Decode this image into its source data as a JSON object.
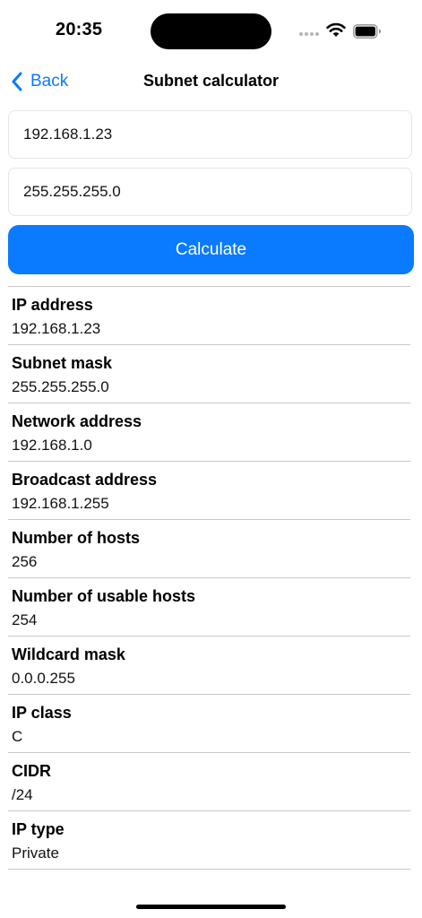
{
  "status_bar": {
    "time": "20:35"
  },
  "nav": {
    "back_label": "Back",
    "title": "Subnet calculator"
  },
  "inputs": {
    "ip_value": "192.168.1.23",
    "mask_value": "255.255.255.0"
  },
  "calculate_label": "Calculate",
  "results": [
    {
      "label": "IP address",
      "value": "192.168.1.23"
    },
    {
      "label": "Subnet mask",
      "value": "255.255.255.0"
    },
    {
      "label": "Network address",
      "value": "192.168.1.0"
    },
    {
      "label": "Broadcast address",
      "value": "192.168.1.255"
    },
    {
      "label": "Number of hosts",
      "value": "256"
    },
    {
      "label": "Number of usable hosts",
      "value": "254"
    },
    {
      "label": "Wildcard mask",
      "value": "0.0.0.255"
    },
    {
      "label": "IP class",
      "value": "C"
    },
    {
      "label": "CIDR",
      "value": "/24"
    },
    {
      "label": "IP type",
      "value": "Private"
    }
  ],
  "colors": {
    "accent": "#0a7aff",
    "divider": "#c8c8c8"
  },
  "icons": {
    "back": "chevron-left-icon",
    "wifi": "wifi-icon",
    "battery": "battery-icon",
    "signal": "signal-dots-icon"
  }
}
